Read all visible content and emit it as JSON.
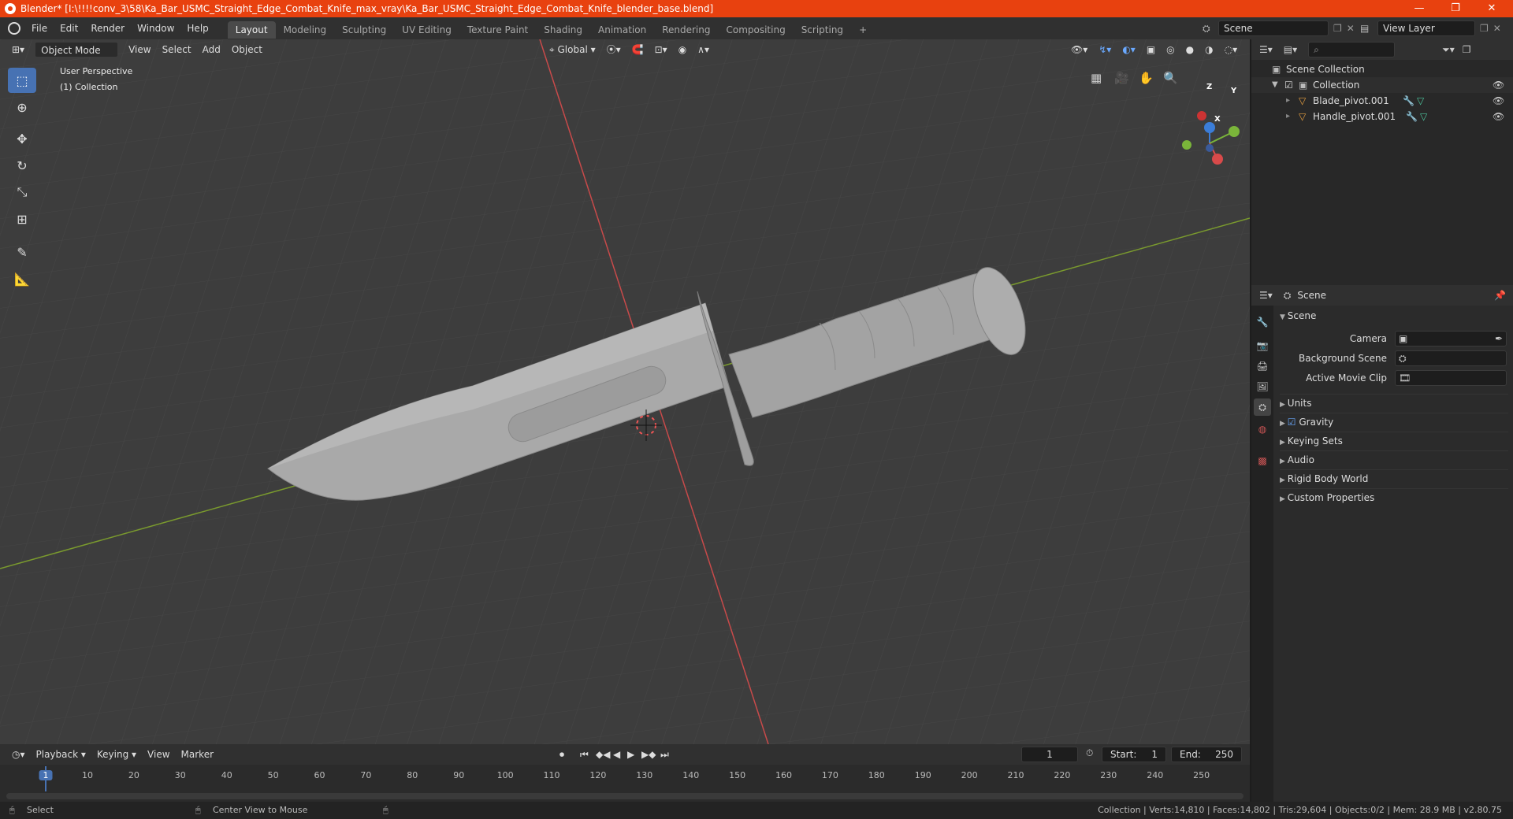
{
  "window": {
    "title": "Blender* [I:\\!!!!conv_3\\58\\Ka_Bar_USMC_Straight_Edge_Combat_Knife_max_vray\\Ka_Bar_USMC_Straight_Edge_Combat_Knife_blender_base.blend]",
    "minimize": "—",
    "maximize": "❐",
    "close": "✕"
  },
  "menus": [
    "File",
    "Edit",
    "Render",
    "Window",
    "Help"
  ],
  "workspaces": [
    "Layout",
    "Modeling",
    "Sculpting",
    "UV Editing",
    "Texture Paint",
    "Shading",
    "Animation",
    "Rendering",
    "Compositing",
    "Scripting"
  ],
  "active_workspace": "Layout",
  "scene_selector": "Scene",
  "view_layer_selector": "View Layer",
  "viewport": {
    "mode": "Object Mode",
    "menus": [
      "View",
      "Select",
      "Add",
      "Object"
    ],
    "transform_orientation": "Global",
    "overlay_line1": "User Perspective",
    "overlay_line2": "(1) Collection",
    "gizmo_axes": {
      "z": "Z",
      "y": "Y",
      "x": "X"
    }
  },
  "outliner": {
    "root": "Scene Collection",
    "collection": "Collection",
    "objects": [
      "Blade_pivot.001",
      "Handle_pivot.001"
    ]
  },
  "properties": {
    "context": "Scene",
    "panel_title": "Scene",
    "camera_label": "Camera",
    "background_scene_label": "Background Scene",
    "active_movie_clip_label": "Active Movie Clip",
    "sections": [
      "Units",
      "Gravity",
      "Keying Sets",
      "Audio",
      "Rigid Body World",
      "Custom Properties"
    ],
    "gravity_checked": true
  },
  "timeline": {
    "menus": [
      "Playback",
      "Keying",
      "View",
      "Marker"
    ],
    "current_frame": "1",
    "start_label": "Start:",
    "start_value": "1",
    "end_label": "End:",
    "end_value": "250",
    "ticks": [
      "1",
      "10",
      "20",
      "30",
      "40",
      "50",
      "60",
      "70",
      "80",
      "90",
      "100",
      "110",
      "120",
      "130",
      "140",
      "150",
      "160",
      "170",
      "180",
      "190",
      "200",
      "210",
      "220",
      "230",
      "240",
      "250"
    ]
  },
  "statusbar": {
    "left": "Select",
    "middle": "Center View to Mouse",
    "right": "Collection | Verts:14,810 | Faces:14,802 | Tris:29,604 | Objects:0/2 | Mem: 28.9 MB | v2.80.75"
  }
}
